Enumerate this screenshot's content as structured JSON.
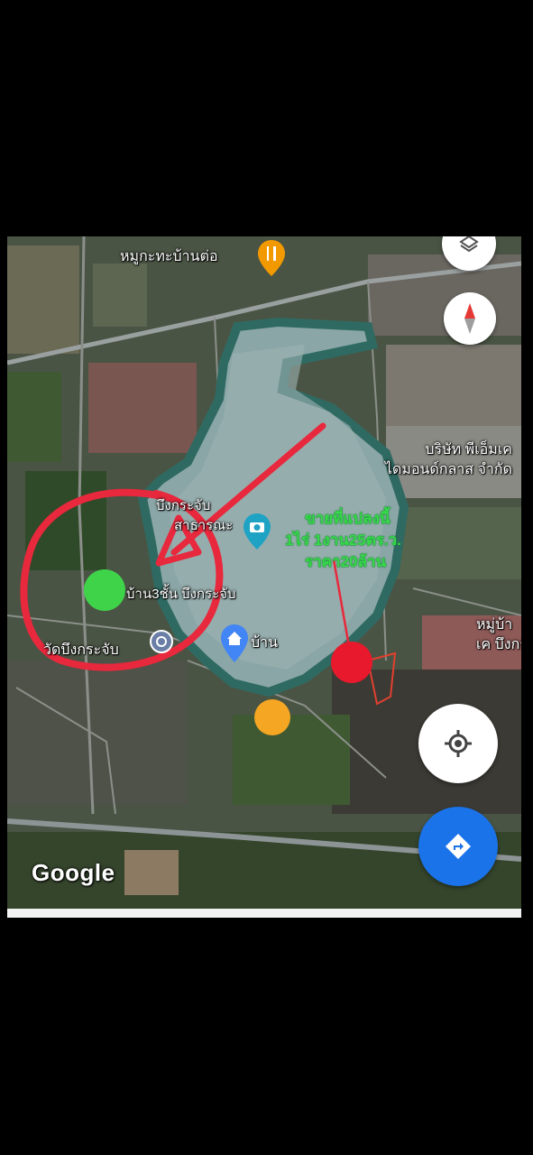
{
  "map": {
    "labels": {
      "restaurant": "หมูกะทะบ้านต่อ",
      "company_line1": "บริษัท พีเอ็มเค",
      "company_line2": "ไดมอนด์กลาส จำกัด",
      "park_line1": "บึงกระจับ",
      "park_line2": "สาธารณะ",
      "house3": "บ้าน3ชั้น บึงกระจับ",
      "temple": "วัดบึงกระจับ",
      "home": "บ้าน",
      "village_line1": "หมู่บ้า",
      "village_line2": "เค บึงกร"
    },
    "annotation": {
      "line1": "ขายที่แปลงนี้",
      "line2": "1ไร่ 1งาน25ตร.ว.",
      "line3": "ราคา20ล้าน"
    },
    "logo": "Google",
    "colors": {
      "circle_red": "#e8283c",
      "marker_green": "#3fd34a",
      "marker_red": "#e8192c",
      "marker_orange": "#f5a623",
      "nav_blue": "#1a73e8",
      "pin_blue": "#4285f4",
      "pin_teal": "#1fa3c4",
      "pin_orange": "#f29900"
    },
    "icons": [
      "layers-icon",
      "compass-icon",
      "my-location-icon",
      "directions-icon",
      "restaurant-pin-icon",
      "camera-pin-icon",
      "home-pin-icon",
      "temple-icon"
    ]
  }
}
